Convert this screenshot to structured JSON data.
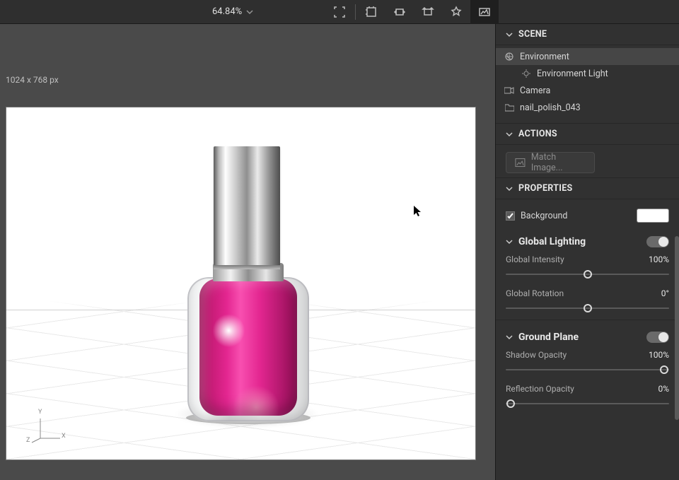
{
  "topbar": {
    "zoom_value": "64.84%"
  },
  "viewport": {
    "dimensions_label": "1024 x 768 px",
    "axis": {
      "x": "X",
      "y": "Y",
      "z": "Z"
    }
  },
  "scene": {
    "header": "SCENE",
    "items": [
      {
        "label": "Environment",
        "icon": "globe-icon",
        "selected": true
      },
      {
        "label": "Environment Light",
        "icon": "light-icon",
        "child": true
      },
      {
        "label": "Camera",
        "icon": "camera-icon"
      },
      {
        "label": "nail_polish_043",
        "icon": "folder-icon"
      }
    ]
  },
  "actions": {
    "header": "ACTIONS",
    "match_image_label": "Match Image..."
  },
  "properties": {
    "header": "PROPERTIES",
    "background": {
      "label": "Background",
      "checked": true,
      "color": "#ffffff"
    },
    "global_lighting": {
      "header": "Global Lighting",
      "enabled": true,
      "global_intensity": {
        "label": "Global Intensity",
        "value_label": "100%",
        "pos": 50
      },
      "global_rotation": {
        "label": "Global Rotation",
        "value_label": "0°",
        "pos": 50
      }
    },
    "ground_plane": {
      "header": "Ground Plane",
      "enabled": true,
      "shadow_opacity": {
        "label": "Shadow Opacity",
        "value_label": "100%",
        "pos": 97
      },
      "reflection_opacity": {
        "label": "Reflection Opacity",
        "value_label": "0%",
        "pos": 3
      }
    }
  }
}
